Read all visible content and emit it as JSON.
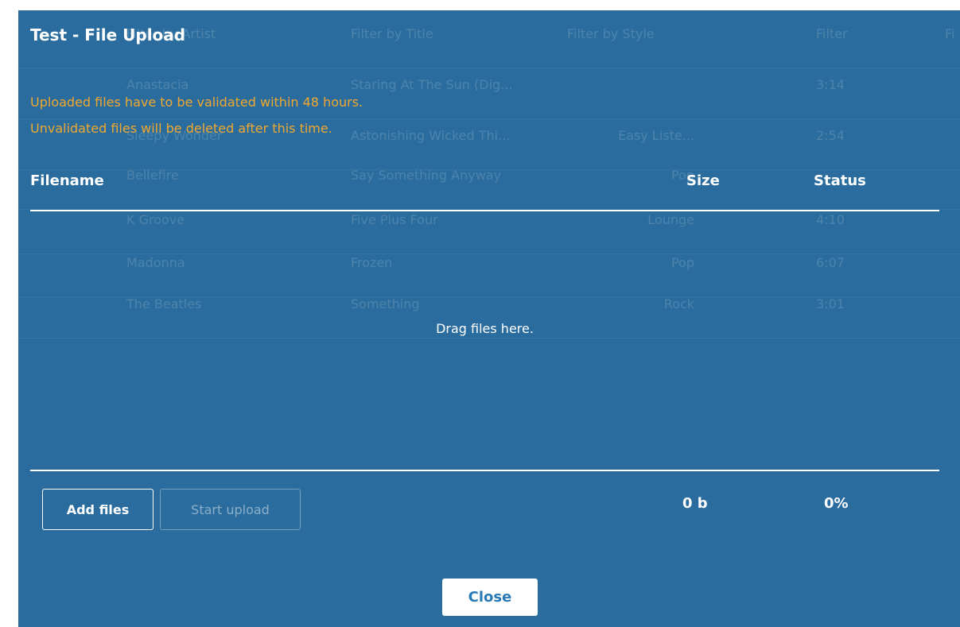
{
  "background_table": {
    "headers": [
      "Filter by Artist",
      "Filter by Title",
      "Filter by Style",
      "Filter",
      "Fi"
    ],
    "rows": [
      [
        "Anastacia",
        "Staring At The Sun (Dig...",
        "",
        "3:14",
        ""
      ],
      [
        "Sleepy Wonder",
        "Astonishing Wicked Thi...",
        "Easy Liste...",
        "2:54",
        ""
      ],
      [
        "Bellefire",
        "Say Something Anyway",
        "Pop",
        "",
        ""
      ],
      [
        "K Groove",
        "Five Plus Four",
        "Lounge",
        "4:10",
        ""
      ],
      [
        "Madonna",
        "Frozen",
        "Pop",
        "6:07",
        ""
      ],
      [
        "The Beatles",
        "Something",
        "Rock",
        "3:01",
        ""
      ]
    ]
  },
  "dialog": {
    "title": "Test - File Upload",
    "notice_line1": "Uploaded files have to be validated within 48 hours.",
    "notice_line2": "Unvalidated files will be deleted after this time.",
    "notice_color": "#f0a830",
    "columns": {
      "filename": "Filename",
      "size": "Size",
      "status": "Status"
    },
    "drop_text": "Drag files here.",
    "add_files_label": "Add files",
    "start_upload_label": "Start upload",
    "total_size": "0 b",
    "total_progress": "0%",
    "close_label": "Close"
  },
  "colors": {
    "overlay": "#2a6c9d",
    "close_text": "#2a7ab5"
  }
}
